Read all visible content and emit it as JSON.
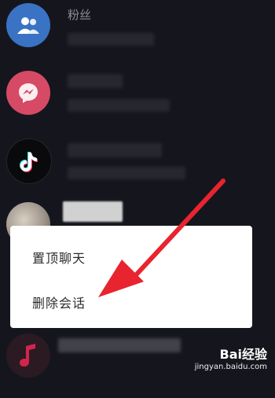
{
  "rows": [
    {
      "title": "粉丝",
      "avatar_icon": "people-icon",
      "avatar_color": "#3a73c4"
    },
    {
      "title": "",
      "avatar_icon": "messenger-icon",
      "avatar_color": "#d64a66"
    },
    {
      "title": "",
      "avatar_icon": "tiktok-icon",
      "avatar_color": "#0a0a0c"
    },
    {
      "title": "",
      "avatar_icon": "user-photo",
      "avatar_color": "#b0a8a0"
    },
    {
      "title": "",
      "avatar_icon": "music-note-icon",
      "avatar_color": "#d3244e"
    }
  ],
  "context_menu": {
    "items": [
      "置顶聊天",
      "删除会话"
    ]
  },
  "arrow_color": "#e8242e",
  "watermark": {
    "brand": "Bai经验",
    "url": "jingyan.baidu.com"
  }
}
